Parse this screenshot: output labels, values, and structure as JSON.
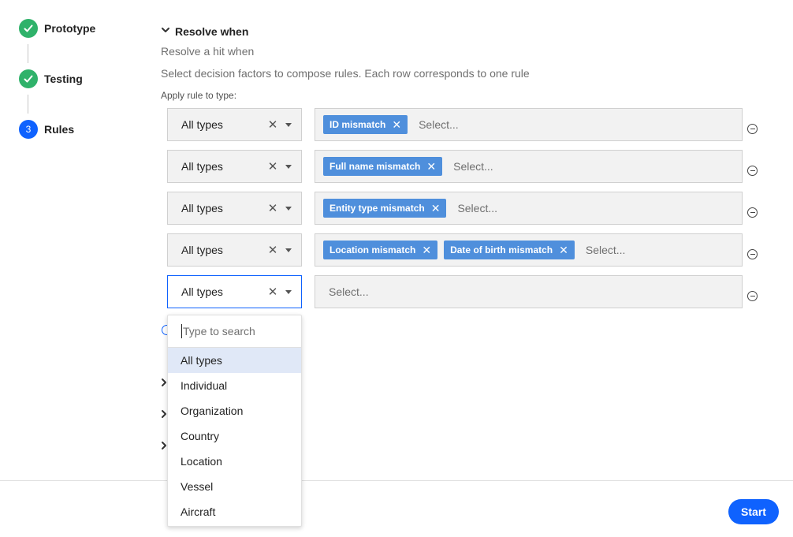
{
  "stepper": {
    "steps": [
      {
        "label": "Prototype",
        "status": "done"
      },
      {
        "label": "Testing",
        "status": "done"
      },
      {
        "label": "Rules",
        "status": "current",
        "number": "3"
      }
    ]
  },
  "section": {
    "title": "Resolve when",
    "subtitle": "Resolve a hit when",
    "description": "Select decision factors to compose rules. Each row corresponds to one rule",
    "apply_label": "Apply rule to type:"
  },
  "rules": [
    {
      "type": "All types",
      "factors": [
        "ID mismatch"
      ],
      "placeholder": "Select..."
    },
    {
      "type": "All types",
      "factors": [
        "Full name mismatch"
      ],
      "placeholder": "Select..."
    },
    {
      "type": "All types",
      "factors": [
        "Entity type mismatch"
      ],
      "placeholder": "Select..."
    },
    {
      "type": "All types",
      "factors": [
        "Location mismatch",
        "Date of birth mismatch"
      ],
      "placeholder": "Select..."
    },
    {
      "type": "All types",
      "factors": [],
      "placeholder": "Select..."
    }
  ],
  "dropdown": {
    "search_placeholder": "Type to search",
    "options": [
      "All types",
      "Individual",
      "Organization",
      "Country",
      "Location",
      "Vessel",
      "Aircraft"
    ],
    "selected": "All types"
  },
  "footer": {
    "start_label": "Start"
  },
  "colors": {
    "accent": "#0f62fe",
    "success": "#2fb26a",
    "tag": "#4f8fdc"
  }
}
